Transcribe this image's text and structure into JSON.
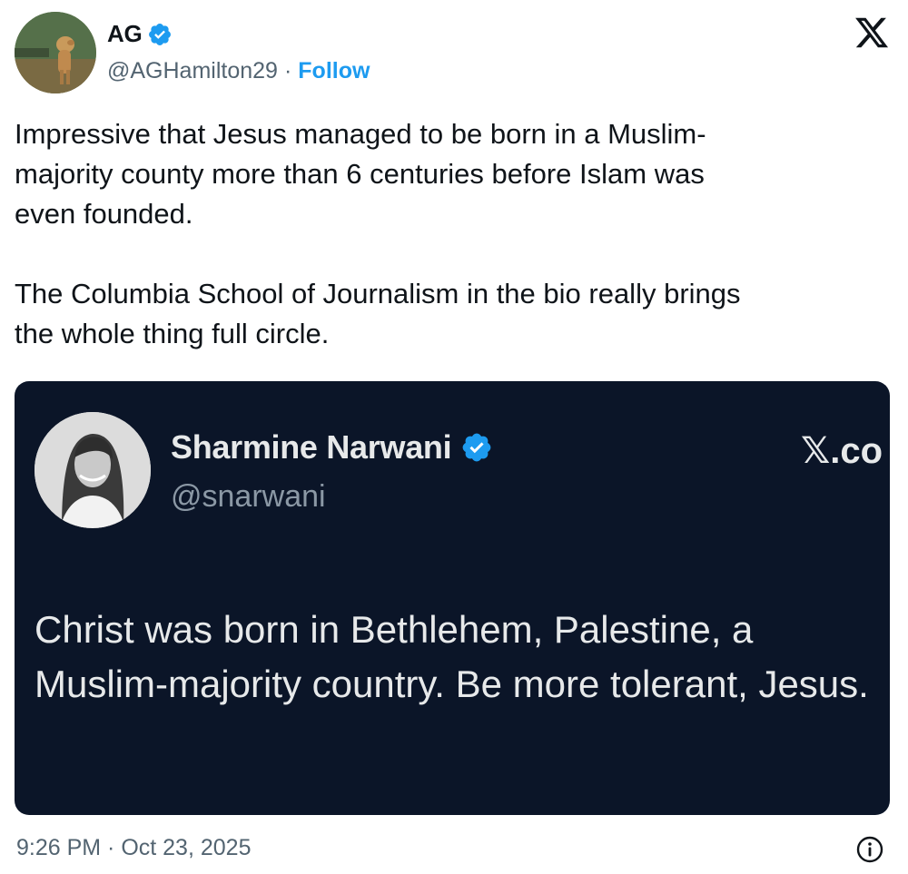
{
  "author": {
    "display_name": "AG",
    "handle": "@AGHamilton29",
    "separator": "·",
    "follow_label": "Follow",
    "verified_color": "#1d9bf0"
  },
  "icons": {
    "avatar": "dog-photo-avatar",
    "verified": "verified-badge-icon",
    "platform": "x-logo-icon",
    "info": "info-circle-icon"
  },
  "tweet": {
    "paragraphs": [
      "Impressive that Jesus managed to be born in a Muslim-\nmajority county more than 6 centuries before Islam was\neven founded.",
      "The Columbia School of Journalism in the bio really brings\nthe whole thing full circle."
    ]
  },
  "quoted": {
    "display_name": "Sharmine Narwani",
    "handle": "@snarwani",
    "brand_text": "𝕏.co",
    "text": "Christ was born in Bethlehem, Palestine, a Muslim-majority country. Be more tolerant, Jesus.",
    "background_color": "#0b1528"
  },
  "footer": {
    "timestamp": "9:26 PM · Oct 23, 2025"
  }
}
